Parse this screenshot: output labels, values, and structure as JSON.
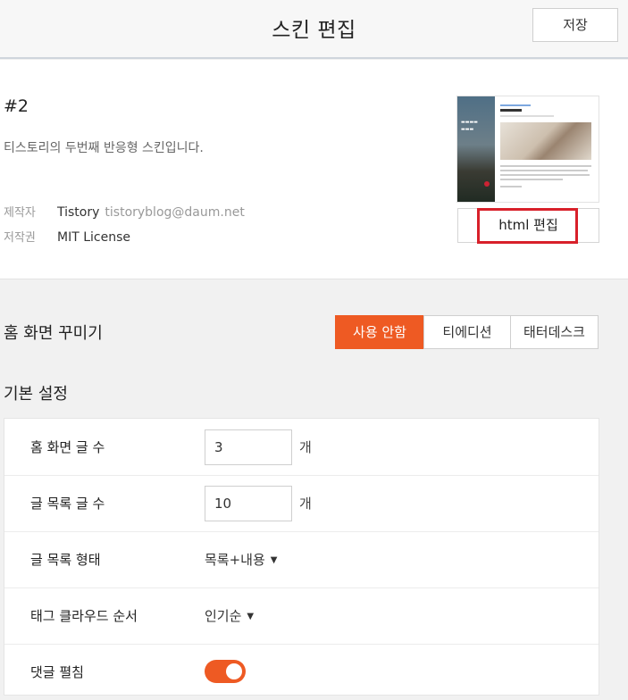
{
  "header": {
    "title": "스킨 편집",
    "save_label": "저장"
  },
  "skin": {
    "name": "#2",
    "description": "티스토리의 두번째 반응형 스킨입니다.",
    "author_label": "제작자",
    "author_name": "Tistory",
    "author_email": "tistoryblog@daum.net",
    "license_label": "저작권",
    "license_value": "MIT License",
    "html_edit_label": "html 편집"
  },
  "home": {
    "title": "홈 화면 꾸미기",
    "options": [
      "사용 안함",
      "티에디션",
      "태터데스크"
    ],
    "selected": "사용 안함"
  },
  "basic": {
    "title": "기본 설정",
    "rows": [
      {
        "label": "홈 화면 글 수",
        "value": "3",
        "unit": "개"
      },
      {
        "label": "글 목록 글 수",
        "value": "10",
        "unit": "개"
      },
      {
        "label": "글 목록 형태",
        "value": "목록+내용"
      },
      {
        "label": "태그 클라우드 순서",
        "value": "인기순"
      },
      {
        "label": "댓글 펼침",
        "toggle_on": true
      }
    ]
  },
  "colors": {
    "accent": "#ee5a23",
    "highlight": "#d8202a"
  }
}
